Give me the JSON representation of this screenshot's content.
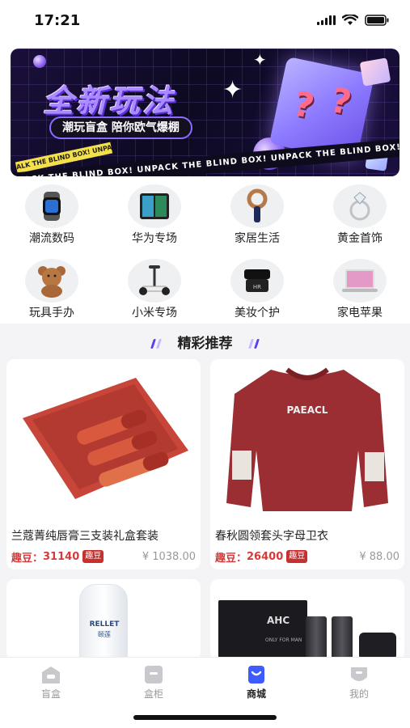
{
  "status_bar": {
    "time": "17:21"
  },
  "banner": {
    "title": "全新玩法",
    "subtitle": "潮玩盲盒 陪你欧气爆棚",
    "tape_text": "UNPACK THE BLIND BOX! UNPACK THE BLIND BOX! UNPACK THE BLIND BOX!",
    "tape_small_text": "ALK THE BLIND BOX! UNPACK THE"
  },
  "categories": [
    {
      "label": "潮流数码",
      "icon": "smartwatch-icon"
    },
    {
      "label": "华为专场",
      "icon": "foldable-phone-icon"
    },
    {
      "label": "家居生活",
      "icon": "hair-dryer-icon"
    },
    {
      "label": "黄金首饰",
      "icon": "diamond-ring-icon"
    },
    {
      "label": "玩具手办",
      "icon": "teddy-bear-icon"
    },
    {
      "label": "小米专场",
      "icon": "balance-scooter-icon"
    },
    {
      "label": "美妆个护",
      "icon": "cream-jar-icon"
    },
    {
      "label": "家电苹果",
      "icon": "laptop-icon"
    }
  ],
  "section": {
    "title": "精彩推荐"
  },
  "products": [
    {
      "name": "兰蔻菁纯唇膏三支装礼盒套装",
      "bean_label": "趣豆：",
      "bean_value": "31140",
      "bean_badge": "趣豆",
      "price": "¥ 1038.00"
    },
    {
      "name": "春秋圆领套头字母卫衣",
      "bean_label": "趣豆：",
      "bean_value": "26400",
      "bean_badge": "趣豆",
      "price": "¥ 88.00",
      "print_text": "PAEACL"
    },
    {
      "brand_text": "RELLET",
      "brand_sub": "颐莲"
    },
    {
      "brand_text": "AHC",
      "brand_sub": "ONLY FOR MAN"
    }
  ],
  "tabbar": [
    {
      "label": "盲盒",
      "icon": "blind-box-icon",
      "active": false
    },
    {
      "label": "盒柜",
      "icon": "cabinet-icon",
      "active": false
    },
    {
      "label": "商城",
      "icon": "mall-icon",
      "active": true
    },
    {
      "label": "我的",
      "icon": "profile-icon",
      "active": false
    }
  ],
  "colors": {
    "accent_red": "#d63a3a",
    "badge_red": "#c83030",
    "active_tab": "#3d5bff",
    "banner_purple": "#a98bff"
  }
}
